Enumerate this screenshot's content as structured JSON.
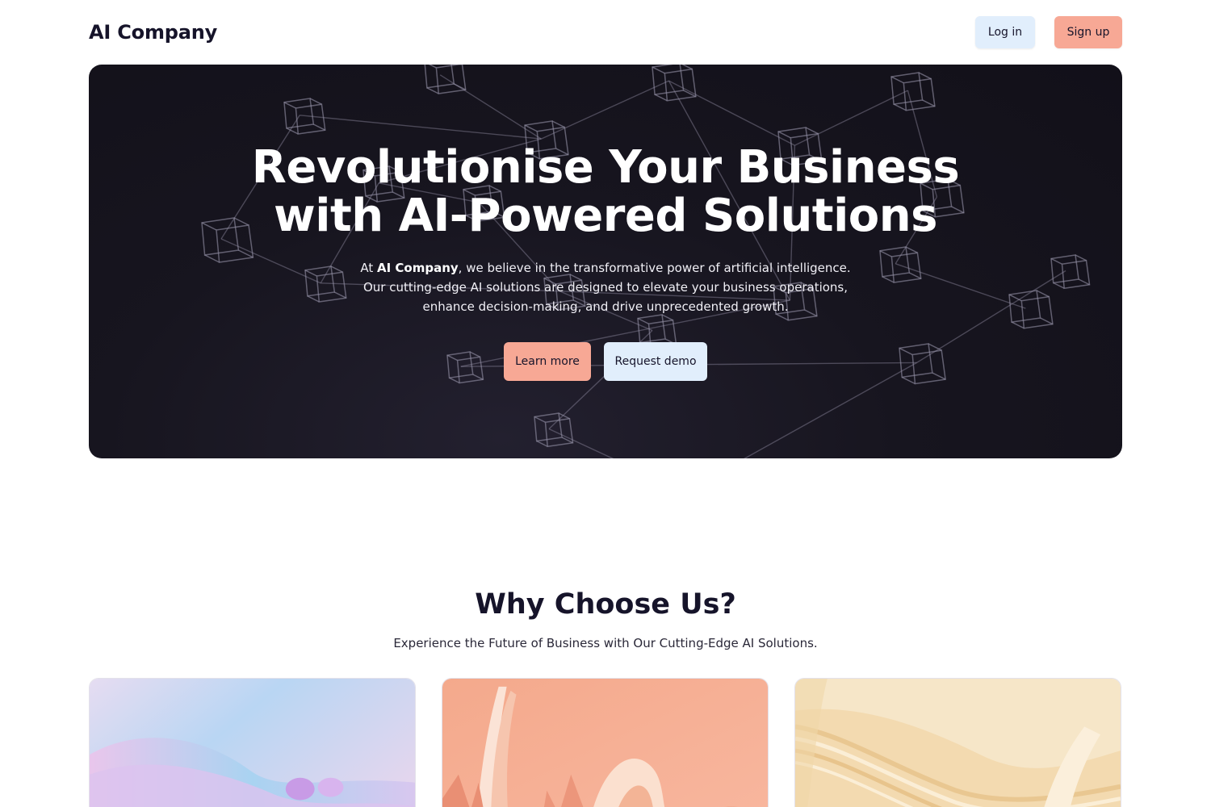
{
  "nav": {
    "logo": "AI Company",
    "login_label": "Log in",
    "signup_label": "Sign up"
  },
  "hero": {
    "title_line1": "Revolutionise Your Business",
    "title_line2": "with AI-Powered Solutions",
    "text_prefix": "At ",
    "text_brand": "AI Company",
    "text_suffix": ", we believe in the transformative power of artificial intelligence. Our cutting-edge AI solutions are designed to elevate your business operations, enhance decision-making, and drive unprecedented growth.",
    "learn_more_label": "Learn more",
    "request_demo_label": "Request demo"
  },
  "why": {
    "title": "Why Choose Us?",
    "subtitle": "Experience the Future of Business with Our Cutting-Edge AI Solutions."
  },
  "colors": {
    "text_dark": "#16142a",
    "button_light": "#e1eefc",
    "button_coral": "#f7a895",
    "hero_bg": "#16141f"
  },
  "cards": [
    {
      "image": "abstract-pastel-waves-image"
    },
    {
      "image": "abstract-peach-ribbons-image"
    },
    {
      "image": "abstract-cream-ribbons-image"
    }
  ]
}
